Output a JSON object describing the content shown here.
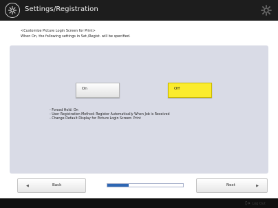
{
  "header": {
    "title": "Settings/Registration",
    "icon": "settings-registration-icon",
    "settings_icon": "gear-icon"
  },
  "description": {
    "line1": "<Customize Picture Login Screen for Print>",
    "line2": "When On, the following settings in Set./Regist. will be specified."
  },
  "options": {
    "on_label": "On",
    "off_label": "Off",
    "selected": "Off"
  },
  "settings_list": [
    "- Forced Hold: On",
    "- User Registration Method: Register Automatically When Job is Received",
    "- Change Default Display for Picture Login Screen: Print"
  ],
  "navigation": {
    "back_label": "Back",
    "next_label": "Next",
    "progress": 0.28
  },
  "footer": {
    "logout_label": "Log Out",
    "logout_icon": "logout-icon"
  },
  "colors": {
    "header_bg": "#1d1d1d",
    "panel_bg": "#d9dbe6",
    "selected_bg": "#fbec2d",
    "progress_fill": "#2d66b3"
  }
}
